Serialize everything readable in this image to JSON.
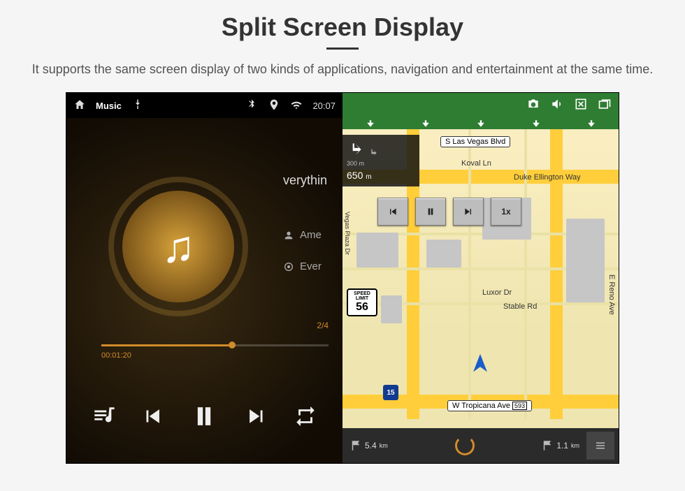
{
  "header": {
    "title": "Split Screen Display",
    "subtitle": "It supports the same screen display of two kinds of applications, navigation and entertainment at the same time."
  },
  "statusbar": {
    "app_label": "Music",
    "clock": "20:07"
  },
  "player": {
    "track_title": "verythin",
    "artist": "Ame",
    "album": "Ever",
    "elapsed": "00:01:20",
    "track_index": "2/4"
  },
  "nav": {
    "top_street": "S Las Vegas Blvd",
    "bottom_street": "W Tropicana Ave",
    "bottom_shield": "593",
    "turn": {
      "primary_dist": "650",
      "primary_unit": "m",
      "secondary": "300 m"
    },
    "btn_speed": "1x",
    "speed_limit": {
      "label": "SPEED LIMIT",
      "value": "56"
    },
    "streets": {
      "koval": "Koval Ln",
      "duke": "Duke Ellington Way",
      "luxor": "Luxor Dr",
      "stable": "Stable Rd",
      "reno": "E Reno Ave",
      "vegasplaza": "Vegas Plaza Dr"
    },
    "hwy_shield": "15",
    "bottom": {
      "left_dist": "5.4",
      "left_unit": "km",
      "right_dist": "1.1",
      "right_unit": "km"
    }
  }
}
